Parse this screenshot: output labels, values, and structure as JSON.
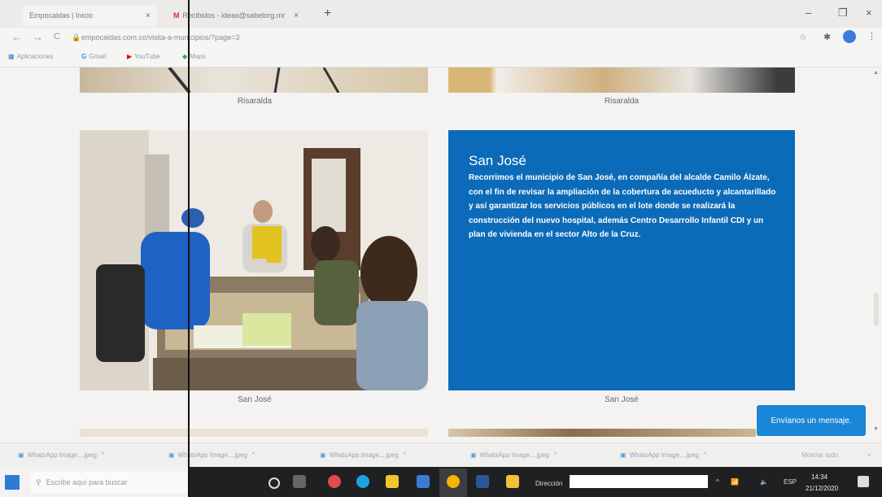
{
  "browser": {
    "tabs": [
      {
        "label": "Empocaldas | Inicio",
        "close": "×"
      },
      {
        "label": "Recibidos - ideas@sabelorg.mr",
        "close": "×"
      }
    ],
    "new_tab": "+",
    "window_controls": {
      "minimize": "–",
      "restore": "❐",
      "close": "×"
    },
    "nav": {
      "back": "←",
      "forward": "→",
      "reload": "C"
    },
    "url": "empocaldas.com.co/visita-a-municipios/?page=3",
    "bookmarks": [
      "Aplicaciones",
      "Gmail",
      "YouTube",
      "Maps"
    ],
    "icons": [
      "star-icon",
      "extension-icon",
      "profile-icon",
      "menu-icon"
    ]
  },
  "page": {
    "top_captions": [
      "Risaralda",
      "Risaralda"
    ],
    "card": {
      "title": "San José",
      "body": "Recorrimos el municipio de San José, en compañía del alcalde Camilo Álzate, con el fin de revisar la ampliación de la cobertura de acueducto y alcantarillado y así garantizar los servicios públicos en el lote donde se realizará la construcción del nuevo hospital, además Centro Desarrollo Infantil CDI y un plan de vivienda en el sector Alto de la Cruz."
    },
    "bottom_captions": [
      "San José",
      "San José"
    ],
    "message_button": "Envíanos un mensaje.",
    "colors": {
      "card_blue": "#0c6bb8",
      "button_blue": "#1a86d8"
    }
  },
  "downloads": {
    "items": [
      "WhatsApp Image....jpeg",
      "WhatsApp Image....jpeg",
      "WhatsApp Image....jpeg",
      "WhatsApp Image....jpeg",
      "WhatsApp Image....jpeg"
    ],
    "show_all": "Mostrar todo",
    "close": "×"
  },
  "taskbar": {
    "search_placeholder": "Escribe aquí para buscar",
    "address_label": "Dirección",
    "language": "ESP",
    "time": "14:34",
    "date": "21/12/2020"
  }
}
